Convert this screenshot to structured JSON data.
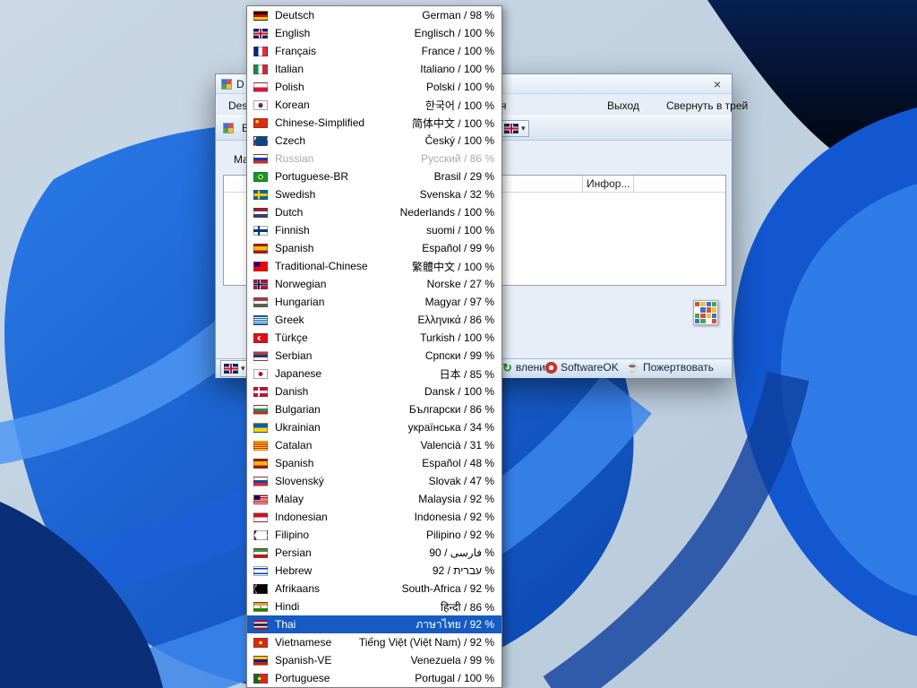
{
  "colors": {
    "selection_blue": "#155bc2",
    "window_chrome": "#e7eef7"
  },
  "glyphs": {
    "close": "×",
    "caret_down": "▾",
    "update": "↻",
    "donate": "☕"
  },
  "window": {
    "title_partial": "D",
    "menu": {
      "left_partial": "Desk",
      "mid_partial": "я",
      "exit_label": "Выход",
      "tray_label": "Свернуть в трей"
    },
    "toolbar": {
      "b_label": "B"
    },
    "side_partial_label": "Ма",
    "list_header_label": "Инфор...",
    "footer": {
      "update_partial_label": "вление",
      "softwareok_label": "SoftwareOK",
      "donate_label": "Пожертвовать"
    },
    "logo_palette": [
      "#d94f3d",
      "#f2c03c",
      "#3a6fd8",
      "#49a64b",
      "#ffffff",
      "#3a6fd8",
      "#d94f3d",
      "#f2c03c",
      "#49a64b",
      "#d94f3d",
      "#f2c03c",
      "#3a6fd8",
      "#3a6fd8",
      "#49a64b",
      "#ffffff",
      "#d94f3d"
    ]
  },
  "language_menu": {
    "items": [
      {
        "name": "Deutsch",
        "detail": "German / 98 %",
        "flag": "de",
        "state": ""
      },
      {
        "name": "English",
        "detail": "Englisch / 100 %",
        "flag": "gb",
        "state": ""
      },
      {
        "name": "Français",
        "detail": "France / 100 %",
        "flag": "fr",
        "state": ""
      },
      {
        "name": "Italian",
        "detail": "Italiano / 100 %",
        "flag": "it",
        "state": ""
      },
      {
        "name": "Polish",
        "detail": "Polski / 100 %",
        "flag": "pl",
        "state": ""
      },
      {
        "name": "Korean",
        "detail": "한국어 / 100 %",
        "flag": "kr",
        "state": ""
      },
      {
        "name": "Chinese-Simplified",
        "detail": "简体中文 / 100 %",
        "flag": "cn",
        "state": ""
      },
      {
        "name": "Czech",
        "detail": "Český / 100 %",
        "flag": "cz",
        "state": ""
      },
      {
        "name": "Russian",
        "detail": "Русский / 86 %",
        "flag": "ru",
        "state": "disabled"
      },
      {
        "name": "Portuguese-BR",
        "detail": "Brasil / 29 %",
        "flag": "br",
        "state": ""
      },
      {
        "name": "Swedish",
        "detail": "Svenska / 32 %",
        "flag": "se",
        "state": ""
      },
      {
        "name": "Dutch",
        "detail": "Nederlands / 100 %",
        "flag": "nl",
        "state": ""
      },
      {
        "name": "Finnish",
        "detail": "suomi / 100 %",
        "flag": "fi",
        "state": ""
      },
      {
        "name": "Spanish",
        "detail": "Español / 99 %",
        "flag": "es",
        "state": ""
      },
      {
        "name": "Traditional-Chinese",
        "detail": "繁體中文 / 100 %",
        "flag": "tw",
        "state": ""
      },
      {
        "name": "Norwegian",
        "detail": "Norske / 27 %",
        "flag": "no",
        "state": ""
      },
      {
        "name": "Hungarian",
        "detail": "Magyar / 97 %",
        "flag": "hu",
        "state": ""
      },
      {
        "name": "Greek",
        "detail": "Ελληνικά / 86 %",
        "flag": "gr",
        "state": ""
      },
      {
        "name": "Türkçe",
        "detail": "Turkish / 100 %",
        "flag": "tr",
        "state": ""
      },
      {
        "name": "Serbian",
        "detail": "Српски / 99 %",
        "flag": "rs",
        "state": ""
      },
      {
        "name": "Japanese",
        "detail": "日本 / 85 %",
        "flag": "jp",
        "state": ""
      },
      {
        "name": "Danish",
        "detail": "Dansk / 100 %",
        "flag": "dk",
        "state": ""
      },
      {
        "name": "Bulgarian",
        "detail": "Български / 86 %",
        "flag": "bg",
        "state": ""
      },
      {
        "name": "Ukrainian",
        "detail": "українська / 34 %",
        "flag": "ua",
        "state": ""
      },
      {
        "name": "Catalan",
        "detail": "Valencià / 31 %",
        "flag": "ct",
        "state": ""
      },
      {
        "name": "Spanish",
        "detail": "Español / 48 %",
        "flag": "es",
        "state": ""
      },
      {
        "name": "Slovenský",
        "detail": "Slovak / 47 %",
        "flag": "sk",
        "state": ""
      },
      {
        "name": "Malay",
        "detail": "Malaysia / 92 %",
        "flag": "my",
        "state": ""
      },
      {
        "name": "Indonesian",
        "detail": "Indonesia / 92 %",
        "flag": "id",
        "state": ""
      },
      {
        "name": "Filipino",
        "detail": "Pilipino / 92 %",
        "flag": "ph",
        "state": ""
      },
      {
        "name": "Persian",
        "detail": "فارسی / 90 %",
        "flag": "ir",
        "state": ""
      },
      {
        "name": "Hebrew",
        "detail": "עברית / 92 %",
        "flag": "il",
        "state": ""
      },
      {
        "name": "Afrikaans",
        "detail": "South-Africa / 92 %",
        "flag": "za",
        "state": ""
      },
      {
        "name": "Hindi",
        "detail": "हिन्दी / 86 %",
        "flag": "in",
        "state": ""
      },
      {
        "name": "Thai",
        "detail": "ภาษาไทย / 92 %",
        "flag": "th",
        "state": "selected"
      },
      {
        "name": "Vietnamese",
        "detail": "Tiếng Việt (Việt Nam) / 92 %",
        "flag": "vn",
        "state": ""
      },
      {
        "name": "Spanish-VE",
        "detail": "Venezuela / 99 %",
        "flag": "ve",
        "state": ""
      },
      {
        "name": "Portuguese",
        "detail": "Portugal / 100 %",
        "flag": "pt",
        "state": ""
      }
    ]
  }
}
